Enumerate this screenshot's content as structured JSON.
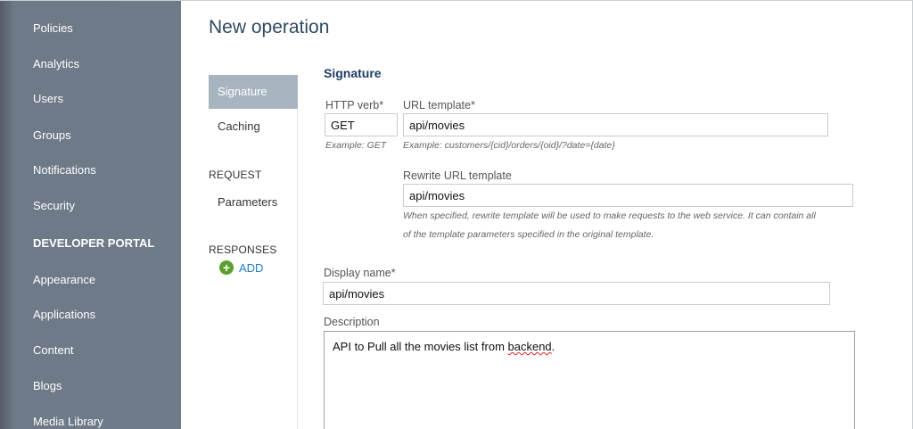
{
  "sidebar": {
    "items": [
      {
        "label": "Policies"
      },
      {
        "label": "Analytics"
      },
      {
        "label": "Users"
      },
      {
        "label": "Groups"
      },
      {
        "label": "Notifications"
      },
      {
        "label": "Security"
      },
      {
        "label": "DEVELOPER PORTAL",
        "section": true
      },
      {
        "label": "Appearance"
      },
      {
        "label": "Applications"
      },
      {
        "label": "Content"
      },
      {
        "label": "Blogs"
      },
      {
        "label": "Media Library"
      }
    ]
  },
  "page": {
    "title": "New operation"
  },
  "subnav": {
    "tabs": [
      {
        "label": "Signature",
        "active": true
      },
      {
        "label": "Caching"
      }
    ],
    "request_label": "REQUEST",
    "parameters_label": "Parameters",
    "responses_label": "RESPONSES",
    "add_label": "ADD"
  },
  "signature": {
    "title": "Signature",
    "http_verb": {
      "label": "HTTP verb*",
      "value": "GET",
      "hint": "Example: GET"
    },
    "url_template": {
      "label": "URL template*",
      "value": "api/movies",
      "hint": "Example: customers/{cid}/orders/{oid}/?date={date}"
    },
    "rewrite": {
      "label": "Rewrite URL template",
      "value": "api/movies",
      "hint_line1": "When specified, rewrite template will be used to make requests to the web service. It can contain all",
      "hint_line2": "of the template parameters specified in the original template."
    },
    "display_name": {
      "label": "Display name*",
      "value": "api/movies"
    },
    "description": {
      "label": "Description",
      "value_prefix": "API to Pull all the movies list from ",
      "value_misspelled": "backend",
      "value_suffix": "."
    }
  }
}
